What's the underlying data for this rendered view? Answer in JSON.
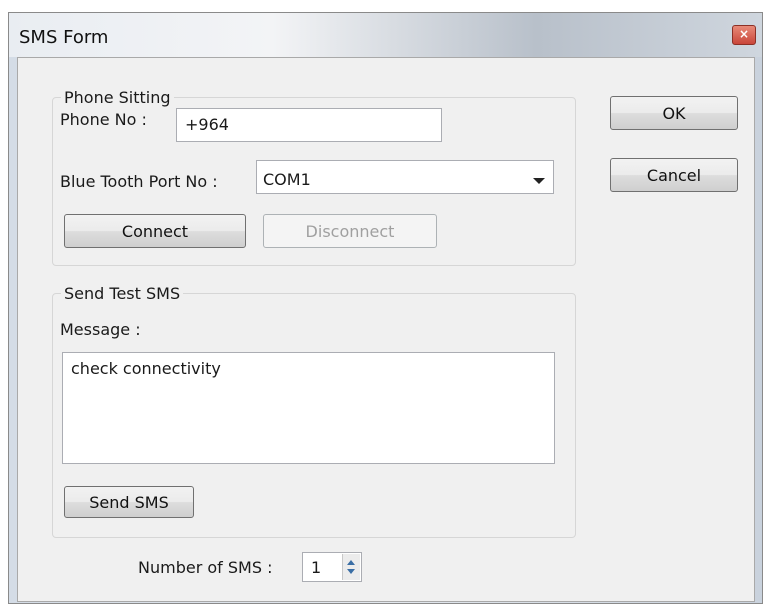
{
  "window": {
    "title": "SMS Form",
    "close_glyph": "×"
  },
  "phone_setting": {
    "legend": "Phone Sitting",
    "phone_label": "Phone No :",
    "phone_value": "+964",
    "port_label": "Blue Tooth Port No :",
    "port_value": "COM1",
    "connect_label": "Connect",
    "disconnect_label": "Disconnect"
  },
  "send_test": {
    "legend": "Send Test SMS",
    "message_label": "Message :",
    "message_value": "check connectivity",
    "send_label": "Send SMS"
  },
  "number_of_sms": {
    "label": "Number of SMS :",
    "value": "1"
  },
  "dialog_buttons": {
    "ok_label": "OK",
    "cancel_label": "Cancel"
  }
}
